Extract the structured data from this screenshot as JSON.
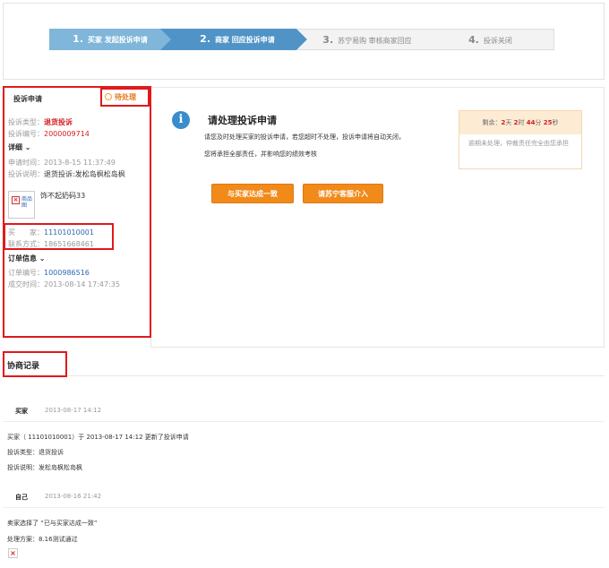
{
  "steps": [
    {
      "num": "1.",
      "label": "买家 发起投诉申请"
    },
    {
      "num": "2.",
      "label": "商家 回应投诉申请"
    },
    {
      "num": "3.",
      "label": "苏宁易购 审核商家回应"
    },
    {
      "num": "4.",
      "label": "投诉关闭"
    }
  ],
  "left": {
    "title": "投诉申请",
    "status": "待处理",
    "type_label": "投诉类型：",
    "type_value": "退货投诉",
    "no_label": "投诉编号：",
    "no_value": "2000009714",
    "detail_head": "详细 ⌄",
    "time_label": "申请时间：",
    "time_value": "2013-8-15 11:37:49",
    "desc_label": "投诉说明：",
    "desc_value": "退货投诉:发松岛枫松岛枫",
    "product_img_text": "商品图",
    "product_name": "饰不起奶码33",
    "buyer_label": "买　　家：",
    "buyer_value": "11101010001",
    "contact_label": "联系方式：",
    "contact_value": "18651668461",
    "order_head": "订单信息 ⌄",
    "order_label": "订单编号：",
    "order_value": "1000986516",
    "deal_label": "成交时间：",
    "deal_value": "2013-08-14 17:47:35"
  },
  "main": {
    "title": "请处理投诉申请",
    "desc1": "请您及时处理买家的投诉申请，若您超时不处理，投诉申请将自动关闭，",
    "desc2": "您将承担全部责任，并影响您的绩效考核",
    "btn_agree": "与买家达成一致",
    "btn_service": "请苏宁客服介入",
    "countdown_prefix": "剩余：",
    "countdown_days": "2",
    "countdown_days_unit": "天",
    "countdown_hours": "2",
    "countdown_hours_unit": "时",
    "countdown_minutes": "44",
    "countdown_minutes_unit": "分",
    "countdown_seconds": "25",
    "countdown_seconds_unit": "秒",
    "countdown_note": "逾期未处理，仲裁责任完全由您承担"
  },
  "records": {
    "title": "协商记录",
    "r1_who": "买家",
    "r1_time": "2013-08-17 14:12",
    "r1_line1": "买家（ 11101010001）于  2013-08-17 14:12  更新了投诉申请",
    "r1_line2": "投诉类型：退货投诉",
    "r1_line3": "投诉说明：发松岛枫松岛枫",
    "r2_who": "自己",
    "r2_time": "2013-08-16 21:42",
    "r2_line1": "卖家选择了 “已与买家达成一致”",
    "r2_line2": "处理方案：8.16测试通过"
  }
}
